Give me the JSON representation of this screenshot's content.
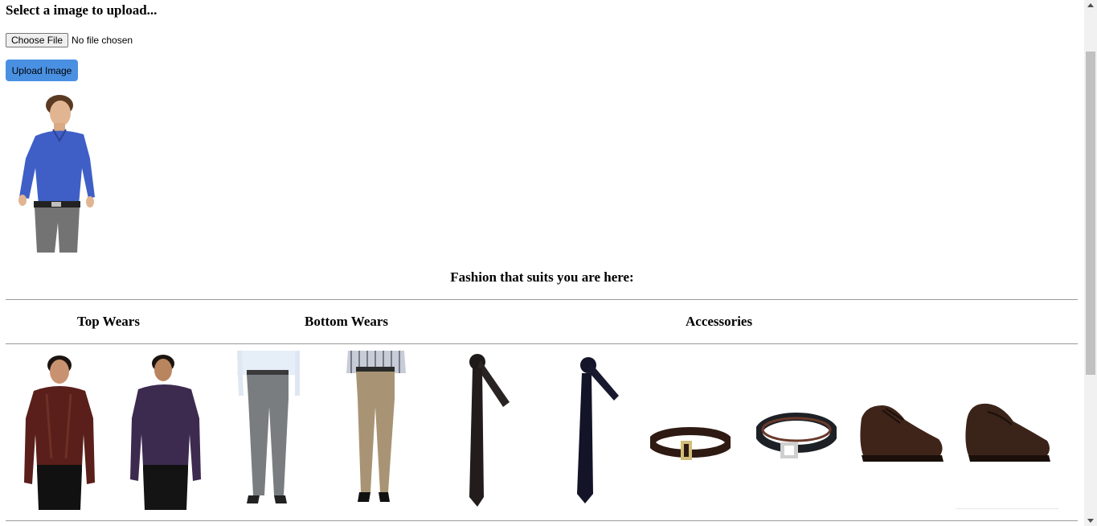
{
  "upload": {
    "heading": "Select a image to upload...",
    "choose_label": "Choose File",
    "file_status": "No file chosen",
    "submit_label": "Upload Image",
    "button_color": "#4a90e2"
  },
  "uploaded_image": {
    "icon": "man-in-blue-shirt-photo"
  },
  "results": {
    "heading": "Fashion that suits you are here:",
    "columns": [
      "Top Wears",
      "Bottom Wears",
      "Accessories"
    ],
    "items": [
      {
        "category": "Top Wears",
        "icon": "maroon-shirt-photo"
      },
      {
        "category": "Top Wears",
        "icon": "purple-shirt-photo"
      },
      {
        "category": "Bottom Wears",
        "icon": "grey-trousers-photo"
      },
      {
        "category": "Bottom Wears",
        "icon": "khaki-trousers-photo"
      },
      {
        "category": "Accessories",
        "icon": "black-tie-photo"
      },
      {
        "category": "Accessories",
        "icon": "navy-tie-photo"
      },
      {
        "category": "Accessories",
        "icon": "brown-belt-photo"
      },
      {
        "category": "Accessories",
        "icon": "black-belt-photo"
      },
      {
        "category": "Accessories",
        "icon": "brown-lace-shoe-photo"
      },
      {
        "category": "Accessories",
        "icon": "brown-loafer-photo"
      }
    ]
  }
}
